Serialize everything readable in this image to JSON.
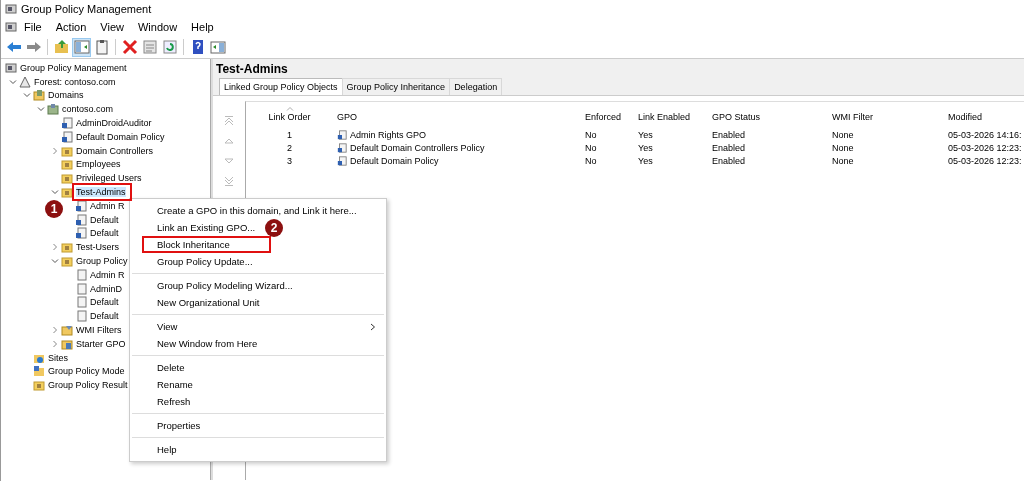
{
  "window": {
    "title": "Group Policy Management"
  },
  "menu_bar": [
    "File",
    "Action",
    "View",
    "Window",
    "Help"
  ],
  "toolbar": [
    {
      "kind": "back",
      "disabled": false
    },
    {
      "kind": "forward",
      "disabled": true
    },
    {
      "kind": "separator"
    },
    {
      "kind": "up-folder",
      "disabled": false
    },
    {
      "kind": "tree-toggle",
      "disabled": false
    },
    {
      "kind": "clipboard",
      "disabled": false
    },
    {
      "kind": "separator"
    },
    {
      "kind": "delete",
      "disabled": false
    },
    {
      "kind": "properties",
      "disabled": false
    },
    {
      "kind": "refresh",
      "disabled": false
    },
    {
      "kind": "separator"
    },
    {
      "kind": "help",
      "disabled": false
    },
    {
      "kind": "view",
      "disabled": false
    }
  ],
  "tree": [
    {
      "label": "Group Policy Management",
      "kind": "console",
      "selected": false,
      "children": [
        {
          "label": "Forest: contoso.com",
          "kind": "forest",
          "expanded": true,
          "selected": false,
          "children": [
            {
              "label": "Domains",
              "kind": "domains",
              "expanded": true,
              "selected": false,
              "children": [
                {
                  "label": "contoso.com",
                  "kind": "domain",
                  "expanded": true,
                  "selected": false,
                  "children": [
                    {
                      "label": "AdminDroidAuditor",
                      "kind": "link",
                      "selected": false
                    },
                    {
                      "label": "Default Domain Policy",
                      "kind": "link",
                      "selected": false
                    },
                    {
                      "label": "Domain Controllers",
                      "kind": "ou",
                      "expanded": false,
                      "selected": false
                    },
                    {
                      "label": "Employees",
                      "kind": "ou",
                      "selected": false
                    },
                    {
                      "label": "Privileged Users",
                      "kind": "ou",
                      "selected": false
                    },
                    {
                      "label": "Test-Admins",
                      "kind": "ou",
                      "expanded": true,
                      "selected": true,
                      "children": [
                        {
                          "label": "Admin R",
                          "kind": "link",
                          "selected": false
                        },
                        {
                          "label": "Default",
                          "kind": "link",
                          "selected": false
                        },
                        {
                          "label": "Default",
                          "kind": "link",
                          "selected": false
                        }
                      ]
                    },
                    {
                      "label": "Test-Users",
                      "kind": "ou",
                      "expanded": false,
                      "selected": false
                    },
                    {
                      "label": "Group Policy",
                      "kind": "gpo-folder",
                      "expanded": true,
                      "selected": false,
                      "children": [
                        {
                          "label": "Admin R",
                          "kind": "gpo",
                          "selected": false
                        },
                        {
                          "label": "AdminD",
                          "kind": "gpo",
                          "selected": false
                        },
                        {
                          "label": "Default",
                          "kind": "gpo",
                          "selected": false
                        },
                        {
                          "label": "Default",
                          "kind": "gpo",
                          "selected": false
                        }
                      ]
                    },
                    {
                      "label": "WMI Filters",
                      "kind": "wmi",
                      "expanded": false,
                      "selected": false
                    },
                    {
                      "label": "Starter GPO",
                      "kind": "starter",
                      "expanded": false,
                      "selected": false
                    }
                  ]
                }
              ]
            },
            {
              "label": "Sites",
              "kind": "sites",
              "selected": false
            },
            {
              "label": "Group Policy Mode",
              "kind": "modeling",
              "selected": false
            },
            {
              "label": "Group Policy Result",
              "kind": "results",
              "selected": false
            }
          ]
        }
      ]
    }
  ],
  "details": {
    "title": "Test-Admins",
    "tabs": [
      {
        "label": "Linked Group Policy Objects",
        "selected": true
      },
      {
        "label": "Group Policy Inheritance",
        "selected": false
      },
      {
        "label": "Delegation",
        "selected": false
      }
    ],
    "order_buttons": [
      {
        "kind": "top",
        "disabled": true
      },
      {
        "kind": "up",
        "disabled": true
      },
      {
        "kind": "down",
        "disabled": true
      },
      {
        "kind": "bottom",
        "disabled": true
      }
    ],
    "table": {
      "columns": [
        {
          "label": "Link Order",
          "sorted": true
        },
        {
          "label": "GPO",
          "sorted": false
        },
        {
          "label": "Enforced",
          "sorted": false
        },
        {
          "label": "Link Enabled",
          "sorted": false
        },
        {
          "label": "GPO Status",
          "sorted": false
        },
        {
          "label": "WMI Filter",
          "sorted": false
        },
        {
          "label": "Modified",
          "sorted": false
        }
      ],
      "rows": [
        [
          "1",
          "Admin Rights GPO",
          "No",
          "Yes",
          "Enabled",
          "None",
          "05-03-2026 14:16:"
        ],
        [
          "2",
          "Default Domain Controllers Policy",
          "No",
          "Yes",
          "Enabled",
          "None",
          "05-03-2026 12:23:"
        ],
        [
          "3",
          "Default Domain Policy",
          "No",
          "Yes",
          "Enabled",
          "None",
          "05-03-2026 12:23:"
        ]
      ]
    }
  },
  "context_menu": [
    {
      "kind": "item",
      "label": "Create a GPO in this domain, and Link it here...",
      "framed": false
    },
    {
      "kind": "item",
      "label": "Link an Existing GPO...",
      "framed": false
    },
    {
      "kind": "item",
      "label": "Block Inheritance",
      "framed": true
    },
    {
      "kind": "item",
      "label": "Group Policy Update...",
      "framed": false
    },
    {
      "kind": "separator"
    },
    {
      "kind": "item",
      "label": "Group Policy Modeling Wizard..."
    },
    {
      "kind": "item",
      "label": "New Organizational Unit"
    },
    {
      "kind": "separator"
    },
    {
      "kind": "item",
      "label": "View",
      "submenu": true
    },
    {
      "kind": "item",
      "label": "New Window from Here"
    },
    {
      "kind": "separator"
    },
    {
      "kind": "item",
      "label": "Delete"
    },
    {
      "kind": "item",
      "label": "Rename"
    },
    {
      "kind": "item",
      "label": "Refresh"
    },
    {
      "kind": "separator"
    },
    {
      "kind": "item",
      "label": "Properties"
    },
    {
      "kind": "separator"
    },
    {
      "kind": "item",
      "label": "Help"
    }
  ],
  "callouts": [
    "1",
    "2"
  ]
}
